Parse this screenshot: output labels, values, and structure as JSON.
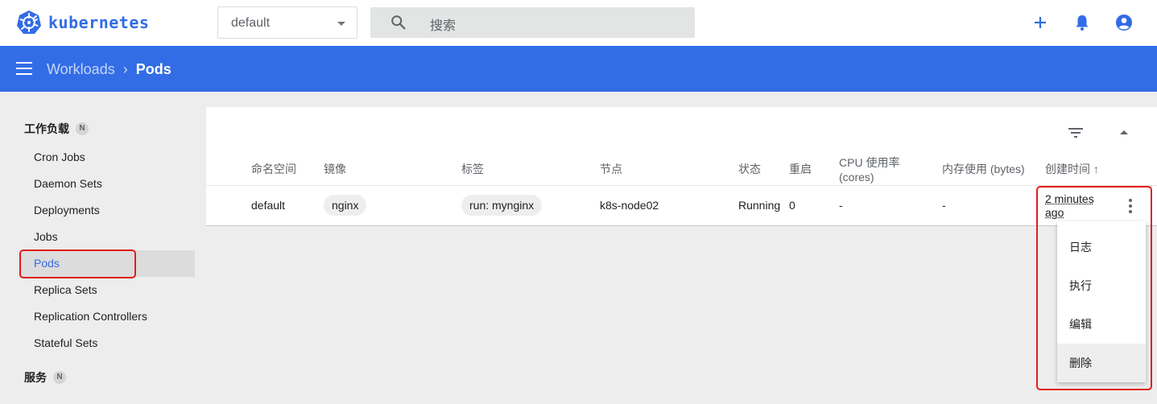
{
  "app": {
    "logo_text": "kubernetes",
    "namespace": "default",
    "search_placeholder": "搜索",
    "brand_color": "#326ce5"
  },
  "header": {
    "breadcrumb_parent": "Workloads",
    "breadcrumb_separator": "›",
    "breadcrumb_current": "Pods",
    "background": "#326de6"
  },
  "sidebar": {
    "group1": {
      "title": "工作负载",
      "badge": "N"
    },
    "items": [
      {
        "label": "Cron Jobs"
      },
      {
        "label": "Daemon Sets"
      },
      {
        "label": "Deployments"
      },
      {
        "label": "Jobs"
      },
      {
        "label": "Pods",
        "active": true
      },
      {
        "label": "Replica Sets"
      },
      {
        "label": "Replication Controllers"
      },
      {
        "label": "Stateful Sets"
      }
    ],
    "group2": {
      "title": "服务",
      "badge": "N"
    }
  },
  "table": {
    "columns": {
      "namespace": "命名空间",
      "image": "镜像",
      "labels": "标签",
      "node": "节点",
      "status": "状态",
      "restarts": "重启",
      "cpu": "CPU 使用率 (cores)",
      "memory": "内存使用 (bytes)",
      "created": "创建时间",
      "sort_arrow": "↑"
    },
    "rows": [
      {
        "namespace": "default",
        "image": "nginx",
        "labels": "run: mynginx",
        "node": "k8s-node02",
        "status": "Running",
        "restarts": "0",
        "cpu": "-",
        "memory": "-",
        "created": "2 minutes ago"
      }
    ]
  },
  "context_menu": {
    "items": [
      {
        "label": "日志"
      },
      {
        "label": "执行"
      },
      {
        "label": "编辑"
      },
      {
        "label": "删除"
      }
    ]
  },
  "icons": [
    "kubernetes-logo-icon",
    "search-icon",
    "plus-icon",
    "bell-icon",
    "account-icon",
    "menu-icon",
    "filter-icon",
    "collapse-icon",
    "kebab-icon"
  ],
  "highlight_color": "#e31b1b"
}
